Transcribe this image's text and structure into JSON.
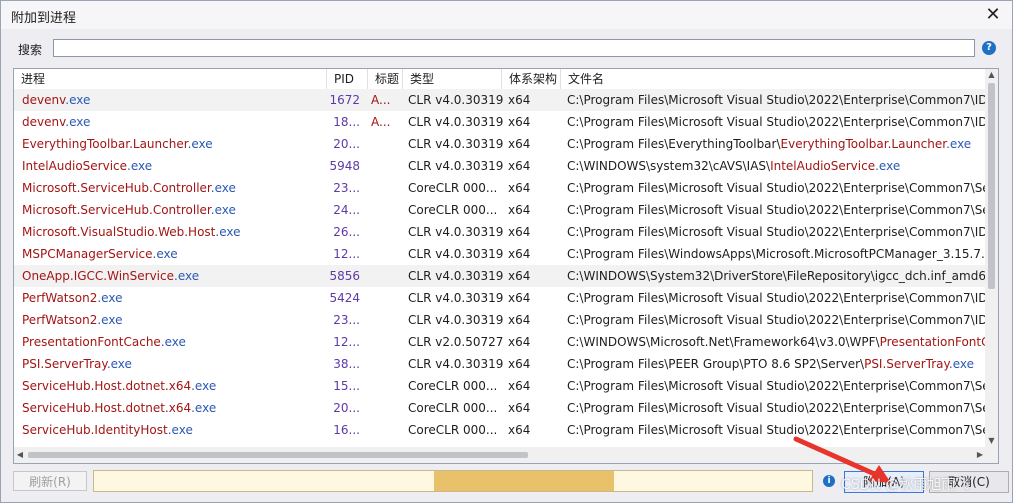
{
  "window": {
    "title": "附加到进程",
    "close_glyph": "✕"
  },
  "search": {
    "label": "搜索",
    "value": "",
    "placeholder": ""
  },
  "help_glyph": "?",
  "columns": [
    "进程",
    "PID",
    "标题",
    "类型",
    "体系架构",
    "文件名"
  ],
  "rows": [
    {
      "name": "devenv",
      "ext": ".exe",
      "pid": "1672",
      "title": "A...",
      "type": "CLR v4.0.30319",
      "arch": "x64",
      "file_pre": "C:\\Program Files\\Microsoft Visual Studio\\2022\\Enterprise\\Common7\\ID",
      "file_hl": "",
      "file_ext": "",
      "selected": true
    },
    {
      "name": "devenv",
      "ext": ".exe",
      "pid": "18...",
      "title": "A...",
      "type": "CLR v4.0.30319",
      "arch": "x64",
      "file_pre": "C:\\Program Files\\Microsoft Visual Studio\\2022\\Enterprise\\Common7\\ID",
      "file_hl": "",
      "file_ext": ""
    },
    {
      "name": "EverythingToolbar.Launcher",
      "ext": ".exe",
      "pid": "20...",
      "title": "",
      "type": "CLR v4.0.30319",
      "arch": "x64",
      "file_pre": "C:\\Program Files\\EverythingToolbar\\",
      "file_hl": "EverythingToolbar.Launcher",
      "file_ext": ".exe"
    },
    {
      "name": "IntelAudioService",
      "ext": ".exe",
      "pid": "5948",
      "title": "",
      "type": "CLR v4.0.30319",
      "arch": "x64",
      "file_pre": "C:\\WINDOWS\\system32\\cAVS\\IAS\\",
      "file_hl": "IntelAudioService",
      "file_ext": ".exe"
    },
    {
      "name": "Microsoft.ServiceHub.Controller",
      "ext": ".exe",
      "pid": "23...",
      "title": "",
      "type": "CoreCLR 000...",
      "arch": "x64",
      "file_pre": "C:\\Program Files\\Microsoft Visual Studio\\2022\\Enterprise\\Common7\\Se",
      "file_hl": "",
      "file_ext": ""
    },
    {
      "name": "Microsoft.ServiceHub.Controller",
      "ext": ".exe",
      "pid": "24...",
      "title": "",
      "type": "CoreCLR 000...",
      "arch": "x64",
      "file_pre": "C:\\Program Files\\Microsoft Visual Studio\\2022\\Enterprise\\Common7\\Se",
      "file_hl": "",
      "file_ext": ""
    },
    {
      "name": "Microsoft.VisualStudio.Web.Host",
      "ext": ".exe",
      "pid": "26...",
      "title": "",
      "type": "CLR v4.0.30319",
      "arch": "x64",
      "file_pre": "C:\\Program Files\\Microsoft Visual Studio\\2022\\Enterprise\\Common7\\ID",
      "file_hl": "",
      "file_ext": ""
    },
    {
      "name": "MSPCManagerService",
      "ext": ".exe",
      "pid": "12...",
      "title": "",
      "type": "CLR v4.0.30319",
      "arch": "x64",
      "file_pre": "C:\\Program Files\\WindowsApps\\Microsoft.MicrosoftPCManager_3.15.7.0",
      "file_hl": "",
      "file_ext": ""
    },
    {
      "name": "OneApp.IGCC.WinService",
      "ext": ".exe",
      "pid": "5856",
      "title": "",
      "type": "CLR v4.0.30319",
      "arch": "x64",
      "file_pre": "C:\\WINDOWS\\System32\\DriverStore\\FileRepository\\igcc_dch.inf_amd64_",
      "file_hl": "",
      "file_ext": "",
      "selected": true
    },
    {
      "name": "PerfWatson2",
      "ext": ".exe",
      "pid": "5424",
      "title": "",
      "type": "CLR v4.0.30319",
      "arch": "x64",
      "file_pre": "C:\\Program Files\\Microsoft Visual Studio\\2022\\Enterprise\\Common7\\ID",
      "file_hl": "",
      "file_ext": ""
    },
    {
      "name": "PerfWatson2",
      "ext": ".exe",
      "pid": "23...",
      "title": "",
      "type": "CLR v4.0.30319",
      "arch": "x64",
      "file_pre": "C:\\Program Files\\Microsoft Visual Studio\\2022\\Enterprise\\Common7\\ID",
      "file_hl": "",
      "file_ext": ""
    },
    {
      "name": "PresentationFontCache",
      "ext": ".exe",
      "pid": "12...",
      "title": "",
      "type": "CLR v2.0.50727",
      "arch": "x64",
      "file_pre": "C:\\WINDOWS\\Microsoft.Net\\Framework64\\v3.0\\WPF\\",
      "file_hl": "PresentationFontC",
      "file_ext": ""
    },
    {
      "name": "PSI.ServerTray",
      "ext": ".exe",
      "pid": "38...",
      "title": "",
      "type": "CLR v4.0.30319",
      "arch": "x64",
      "file_pre": "C:\\Program Files\\PEER Group\\PTO 8.6 SP2\\Server\\",
      "file_hl": "PSI.ServerTray",
      "file_ext": ".exe"
    },
    {
      "name": "ServiceHub.Host.dotnet.x64",
      "ext": ".exe",
      "pid": "15...",
      "title": "",
      "type": "CoreCLR 000...",
      "arch": "x64",
      "file_pre": "C:\\Program Files\\Microsoft Visual Studio\\2022\\Enterprise\\Common7\\Se",
      "file_hl": "",
      "file_ext": ""
    },
    {
      "name": "ServiceHub.Host.dotnet.x64",
      "ext": ".exe",
      "pid": "20...",
      "title": "",
      "type": "CoreCLR 000...",
      "arch": "x64",
      "file_pre": "C:\\Program Files\\Microsoft Visual Studio\\2022\\Enterprise\\Common7\\Se",
      "file_hl": "",
      "file_ext": ""
    },
    {
      "name": "ServiceHub.IdentityHost",
      "ext": ".exe",
      "pid": "16...",
      "title": "",
      "type": "CoreCLR 000...",
      "arch": "x64",
      "file_pre": "C:\\Program Files\\Microsoft Visual Studio\\2022\\Enterprise\\Common7\\Se",
      "file_hl": "",
      "file_ext": ""
    }
  ],
  "footer": {
    "refresh_label": "刷新(R)",
    "info_glyph": "i",
    "attach_label": "附加(A)",
    "cancel_label": "取消(C)",
    "watermark": "CSDN @秋雨旭雨飞"
  },
  "colors": {
    "process_name": "#a31515",
    "extension": "#2b58b3",
    "pid": "#5e3aa6",
    "annotation_arrow": "#e8352b"
  }
}
